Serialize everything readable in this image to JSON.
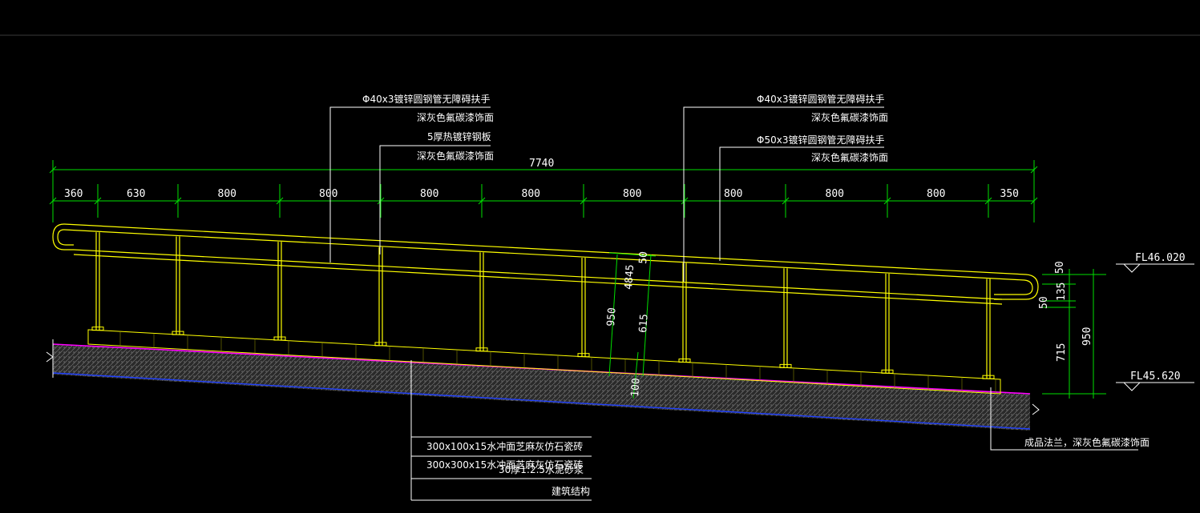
{
  "labels": {
    "top_left_1": "Φ40x3镀锌圆钢管无障碍扶手",
    "top_left_2": "深灰色氟碳漆饰面",
    "top_left_3": "5厚热镀锌钢板",
    "top_left_4": "深灰色氟碳漆饰面",
    "top_right_1": "Φ40x3镀锌圆钢管无障碍扶手",
    "top_right_2": "深灰色氟碳漆饰面",
    "top_right_3": "Φ50x3镀锌圆钢管无障碍扶手",
    "top_right_4": "深灰色氟碳漆饰面",
    "bottom_1": "300x100x15水冲面芝麻灰仿石瓷砖",
    "bottom_2": "300x300x15水冲面芝麻灰仿石瓷砖",
    "bottom_3": "30厚1:2.5水泥砂浆",
    "bottom_4": "建筑结构",
    "flange": "成品法兰，深灰色氟碳漆饰面"
  },
  "dimensions": {
    "total": "7740",
    "segments": [
      "360",
      "630",
      "800",
      "800",
      "800",
      "800",
      "800",
      "800",
      "800",
      "800",
      "350"
    ],
    "inner_950": "950",
    "inner_615": "615",
    "inner_4845": "4845",
    "inner_50": "50",
    "inner_100": "100",
    "right_50_top": "50",
    "right_135": "135",
    "right_50_bottom": "50",
    "right_715": "715",
    "right_950": "950"
  },
  "levels": {
    "upper": "FL46.020",
    "lower": "FL45.620"
  },
  "colors": {
    "background": "#000000",
    "handrail": "#ffff00",
    "leader": "#00e000",
    "finish_line": "#ff00ff",
    "structure_line": "#2040ff",
    "text": "#ffffff"
  }
}
